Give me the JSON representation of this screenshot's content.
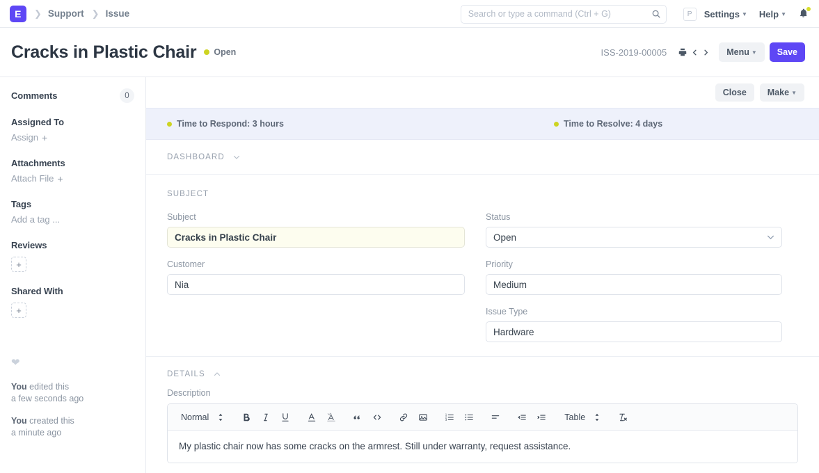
{
  "navbar": {
    "logo_letter": "E",
    "breadcrumbs": [
      {
        "label": "Support"
      },
      {
        "label": "Issue"
      }
    ],
    "search": {
      "value": "",
      "placeholder": "Search or type a command (Ctrl + G)"
    },
    "avatar_letter": "P",
    "settings_label": "Settings",
    "help_label": "Help"
  },
  "page_head": {
    "title": "Cracks in Plastic Chair",
    "status": "Open",
    "status_color": "#cdd422",
    "doc_name": "ISS-2019-00005",
    "menu_label": "Menu",
    "save_label": "Save"
  },
  "sidebar": {
    "comments_label": "Comments",
    "comments_count": "0",
    "assigned_to_label": "Assigned To",
    "assign_label": "Assign",
    "attachments_label": "Attachments",
    "attach_file_label": "Attach File",
    "tags_label": "Tags",
    "add_tag_label": "Add a tag ...",
    "reviews_label": "Reviews",
    "shared_with_label": "Shared With",
    "plus_symbol": "+",
    "activity": [
      {
        "actor": "You",
        "action": " edited this",
        "time": "a few seconds ago"
      },
      {
        "actor": "You",
        "action": " created this",
        "time": "a minute ago"
      }
    ]
  },
  "action_bar": {
    "close_label": "Close",
    "make_label": "Make"
  },
  "sla": {
    "respond": "Time to Respond: 3 hours",
    "resolve": "Time to Resolve: 4 days",
    "dot_color": "#cdd422"
  },
  "sections": {
    "dashboard_label": "DASHBOARD",
    "subject_label": "SUBJECT",
    "details_label": "DETAILS"
  },
  "form": {
    "subject": {
      "label": "Subject",
      "value": "Cracks in Plastic Chair"
    },
    "customer": {
      "label": "Customer",
      "value": "Nia"
    },
    "status": {
      "label": "Status",
      "value": "Open"
    },
    "priority": {
      "label": "Priority",
      "value": "Medium"
    },
    "issue_type": {
      "label": "Issue Type",
      "value": "Hardware"
    }
  },
  "editor": {
    "label": "Description",
    "style_dropdown": "Normal",
    "table_dropdown": "Table",
    "content": "My plastic chair now has some cracks on the armrest. Still under warranty, request assistance."
  },
  "theme": {
    "primary": "#5e47f5",
    "sla_bg": "#eef1fb",
    "highlight_field_bg": "#fdfdef"
  }
}
